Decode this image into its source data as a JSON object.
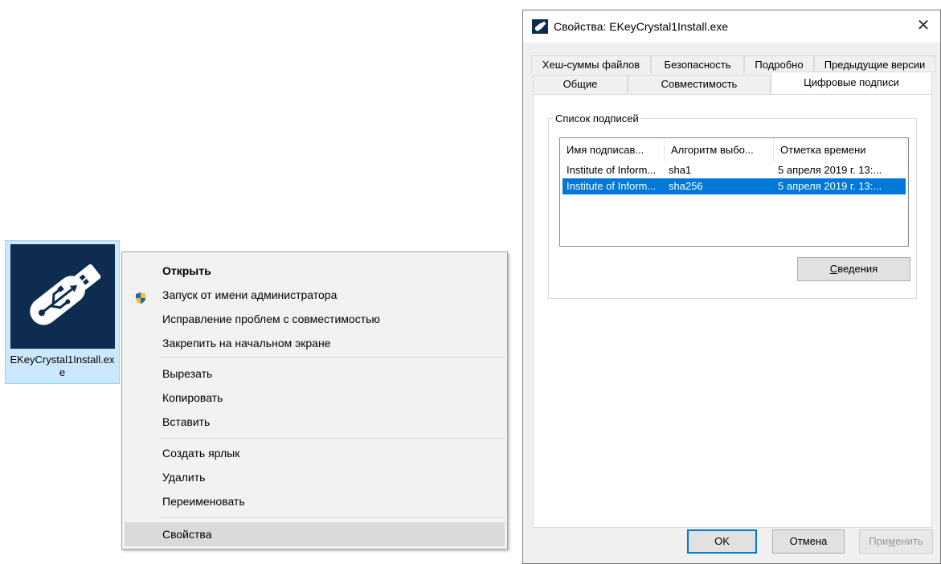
{
  "desktop": {
    "file_name": "EKeyCrystal1Install.exe",
    "icon": "usb-drive-icon"
  },
  "context_menu": {
    "items": [
      {
        "label": "Открыть",
        "bold": true
      },
      {
        "label": "Запуск от имени администратора",
        "icon": "uac-shield-icon"
      },
      {
        "label": "Исправление проблем с совместимостью"
      },
      {
        "label": "Закрепить на начальном экране"
      },
      {
        "label": "Вырезать"
      },
      {
        "label": "Копировать"
      },
      {
        "label": "Вставить"
      },
      {
        "label": "Создать ярлык"
      },
      {
        "label": "Удалить"
      },
      {
        "label": "Переименовать"
      },
      {
        "label": "Свойства",
        "highlighted": true
      }
    ]
  },
  "dialog": {
    "title": "Свойства: EKeyCrystal1Install.exe",
    "close_glyph": "✕",
    "tabs_row1": [
      "Хеш-суммы файлов",
      "Безопасность",
      "Подробно",
      "Предыдущие версии"
    ],
    "tabs_row2": [
      "Общие",
      "Совместимость",
      "Цифровые подписи"
    ],
    "active_tab": "Цифровые подписи",
    "signatures": {
      "group_label": "Список подписей",
      "columns": [
        "Имя подписав...",
        "Алгоритм выбо...",
        "Отметка времени"
      ],
      "rows": [
        [
          "Institute of Inform...",
          "sha1",
          "5 апреля 2019 г. 13:..."
        ],
        [
          "Institute of Inform...",
          "sha256",
          "5 апреля 2019 г. 13:..."
        ]
      ],
      "selected_row": 1,
      "details_button": "Сведения"
    },
    "buttons": {
      "ok": "OK",
      "cancel": "Отмена",
      "apply": "Применить"
    },
    "colors": {
      "selection": "#0078d7",
      "icon_bg": "#0d2c4f",
      "file_selected_bg": "#cce8ff"
    }
  }
}
